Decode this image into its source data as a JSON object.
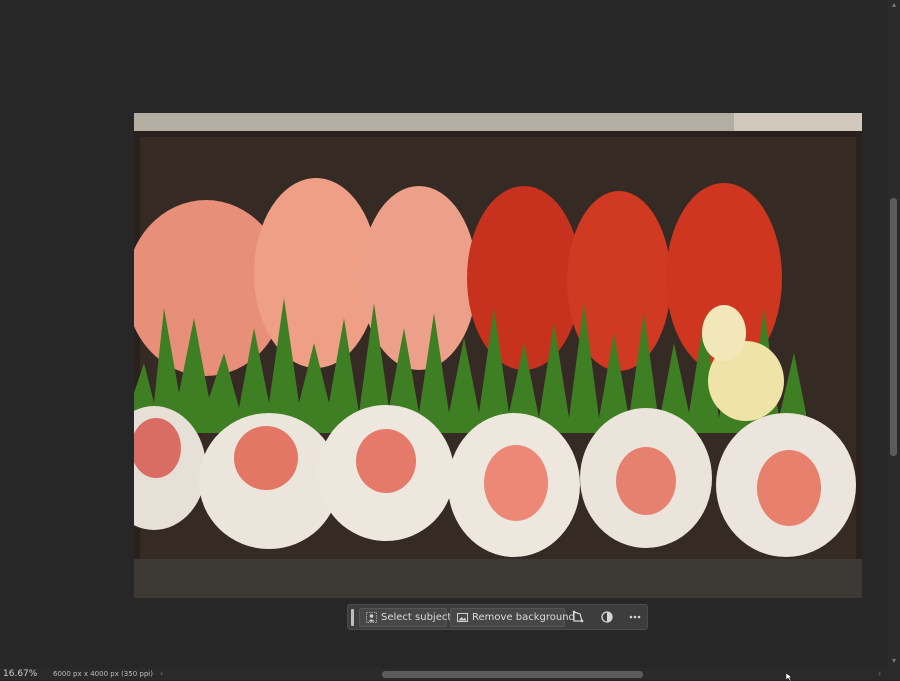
{
  "canvas": {
    "image_alt": "Photo of a sushi box with salmon and tuna nigiri and tuna rolls"
  },
  "task_bar": {
    "select_subject_label": "Select subject",
    "remove_background_label": "Remove background",
    "icons": [
      "person-select-icon",
      "image-remove-bg-icon",
      "transform-icon",
      "adjust-circle-icon",
      "more-dots-icon"
    ]
  },
  "status_bar": {
    "zoom": "16.67%",
    "document_info": "6000 px x 4000 px (350 ppi)",
    "arrow": "›"
  },
  "scrollbars": {
    "vertical_up": "▴",
    "vertical_down": "▾",
    "horizontal_left": "‹",
    "horizontal_right": "›"
  }
}
